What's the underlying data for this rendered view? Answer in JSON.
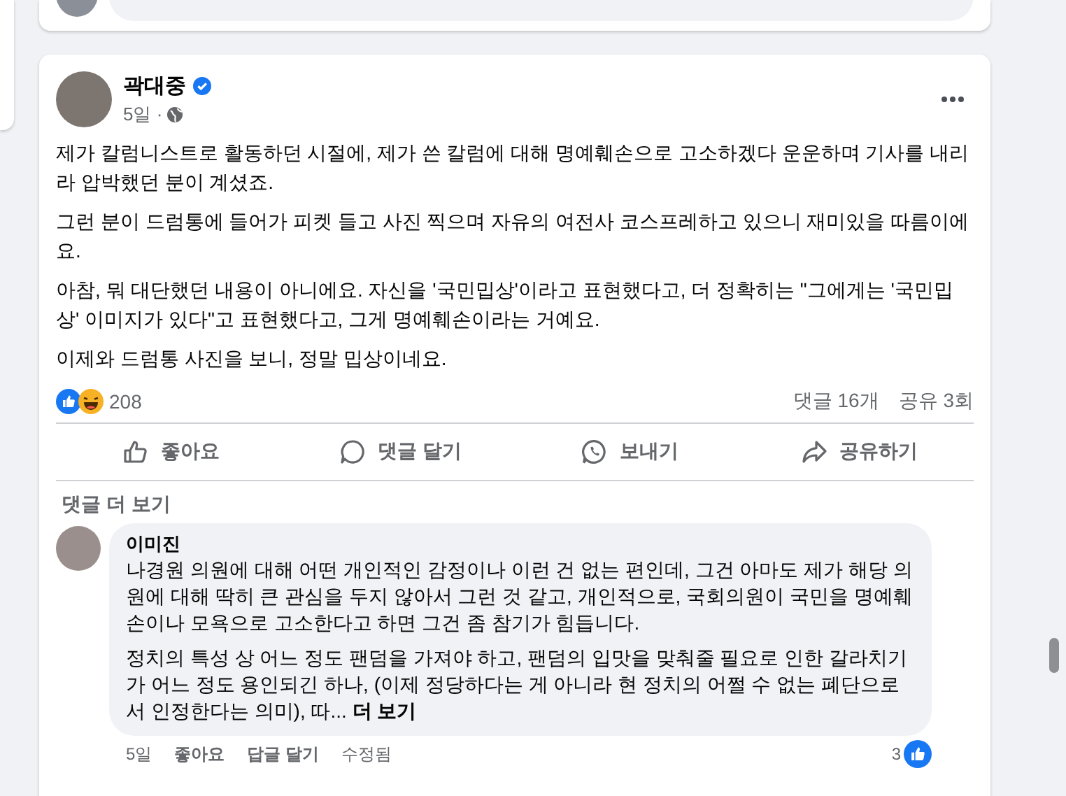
{
  "post": {
    "author": "곽대중",
    "verified": true,
    "time": "5일 ·",
    "paragraphs": [
      "제가 칼럼니스트로 활동하던 시절에, 제가 쓴 칼럼에 대해 명예훼손으로 고소하겠다 운운하며 기사를 내리라 압박했던 분이 계셨죠.",
      "그런 분이 드럼통에 들어가 피켓 들고 사진 찍으며 자유의 여전사 코스프레하고 있으니 재미있을 따름이에요.",
      "아참, 뭐 대단했던 내용이 아니에요. 자신을 '국민밉상'이라고 표현했다고, 더 정확히는 \"그에게는 '국민밉상' 이미지가 있다\"고 표현했다고, 그게 명예훼손이라는 거예요.",
      "이제와 드럼통 사진을 보니, 정말 밉상이네요."
    ],
    "reaction_count": "208",
    "comments_count": "댓글 16개",
    "shares_count": "공유 3회",
    "actions": [
      {
        "kind": "like",
        "label": "좋아요"
      },
      {
        "kind": "comment",
        "label": "댓글 달기"
      },
      {
        "kind": "send",
        "label": "보내기"
      },
      {
        "kind": "share",
        "label": "공유하기"
      }
    ],
    "more_comments": "댓글 더 보기",
    "comments": [
      {
        "author": "이미진",
        "paragraphs": [
          "나경원 의원에 대해 어떤 개인적인 감정이나 이런 건 없는 편인데, 그건 아마도 제가 해당 의원에 대해 딱히 큰 관심을 두지 않아서 그런 것 같고, 개인적으로, 국회의원이 국민을 명예훼손이나 모욕으로 고소한다고 하면 그건 좀 참기가 힘듭니다.",
          "정치의 특성 상 어느 정도 팬덤을 가져야 하고, 팬덤의 입맛을 맞춰줄 필요로 인한 갈라치기가 어느 정도 용인되긴 하나, (이제 정당하다는 게 아니라 현 정치의 어쩔 수 없는 폐단으로서 인정한다는 의미), 따... **더 보기**"
        ],
        "time": "5일",
        "like": "좋아요",
        "reply": "답글 달기",
        "edited": "수정됨",
        "reaction_count": "3"
      }
    ]
  }
}
